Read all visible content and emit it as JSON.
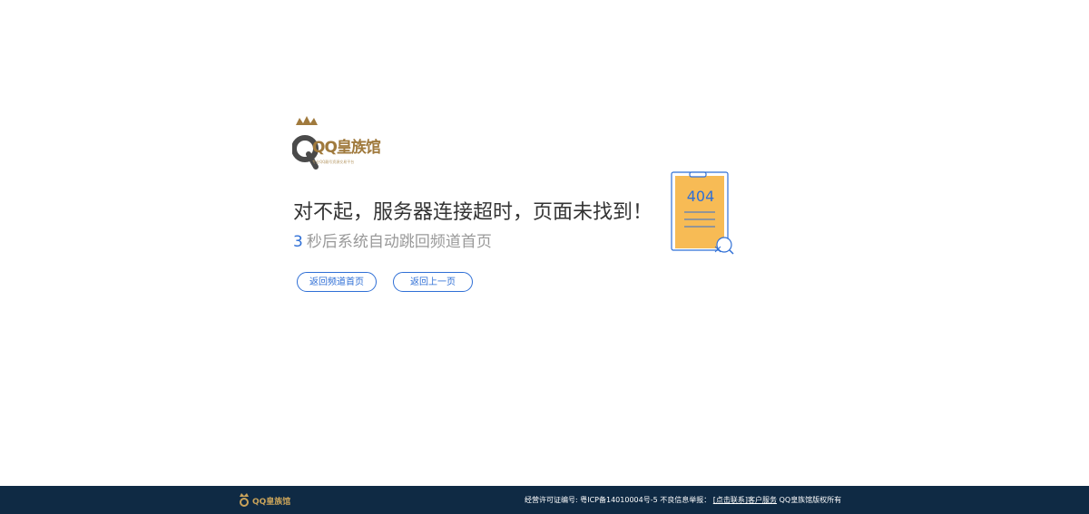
{
  "logo": {
    "text": "QQ皇族馆",
    "subtitle": "专业QQ靓号资源交易平台",
    "icon": "crown-q-logo",
    "color": "#a07a3d"
  },
  "message": {
    "headline": "对不起，服务器连接超时，页面未找到！",
    "countdown_number": "3",
    "countdown_text": "秒后系统自动跳回频道首页"
  },
  "buttons": {
    "home_label": "返回频道首页",
    "back_label": "返回上一页"
  },
  "illustration": {
    "code": "404",
    "icon": "clipboard-404-icon"
  },
  "footer": {
    "logo_text": "QQ皇族馆",
    "license": "经营许可证编号: 粤ICP备14010004号-5",
    "report_label": "不良信息举报：",
    "contact_link": "[点击联系]",
    "service_link": "客户服务",
    "copyright": "QQ皇族馆版权所有"
  },
  "colors": {
    "accent": "#2f6fd6",
    "footer_bg": "#0f2a44",
    "clipboard": "#f7bb55",
    "gold": "#a07a3d"
  }
}
